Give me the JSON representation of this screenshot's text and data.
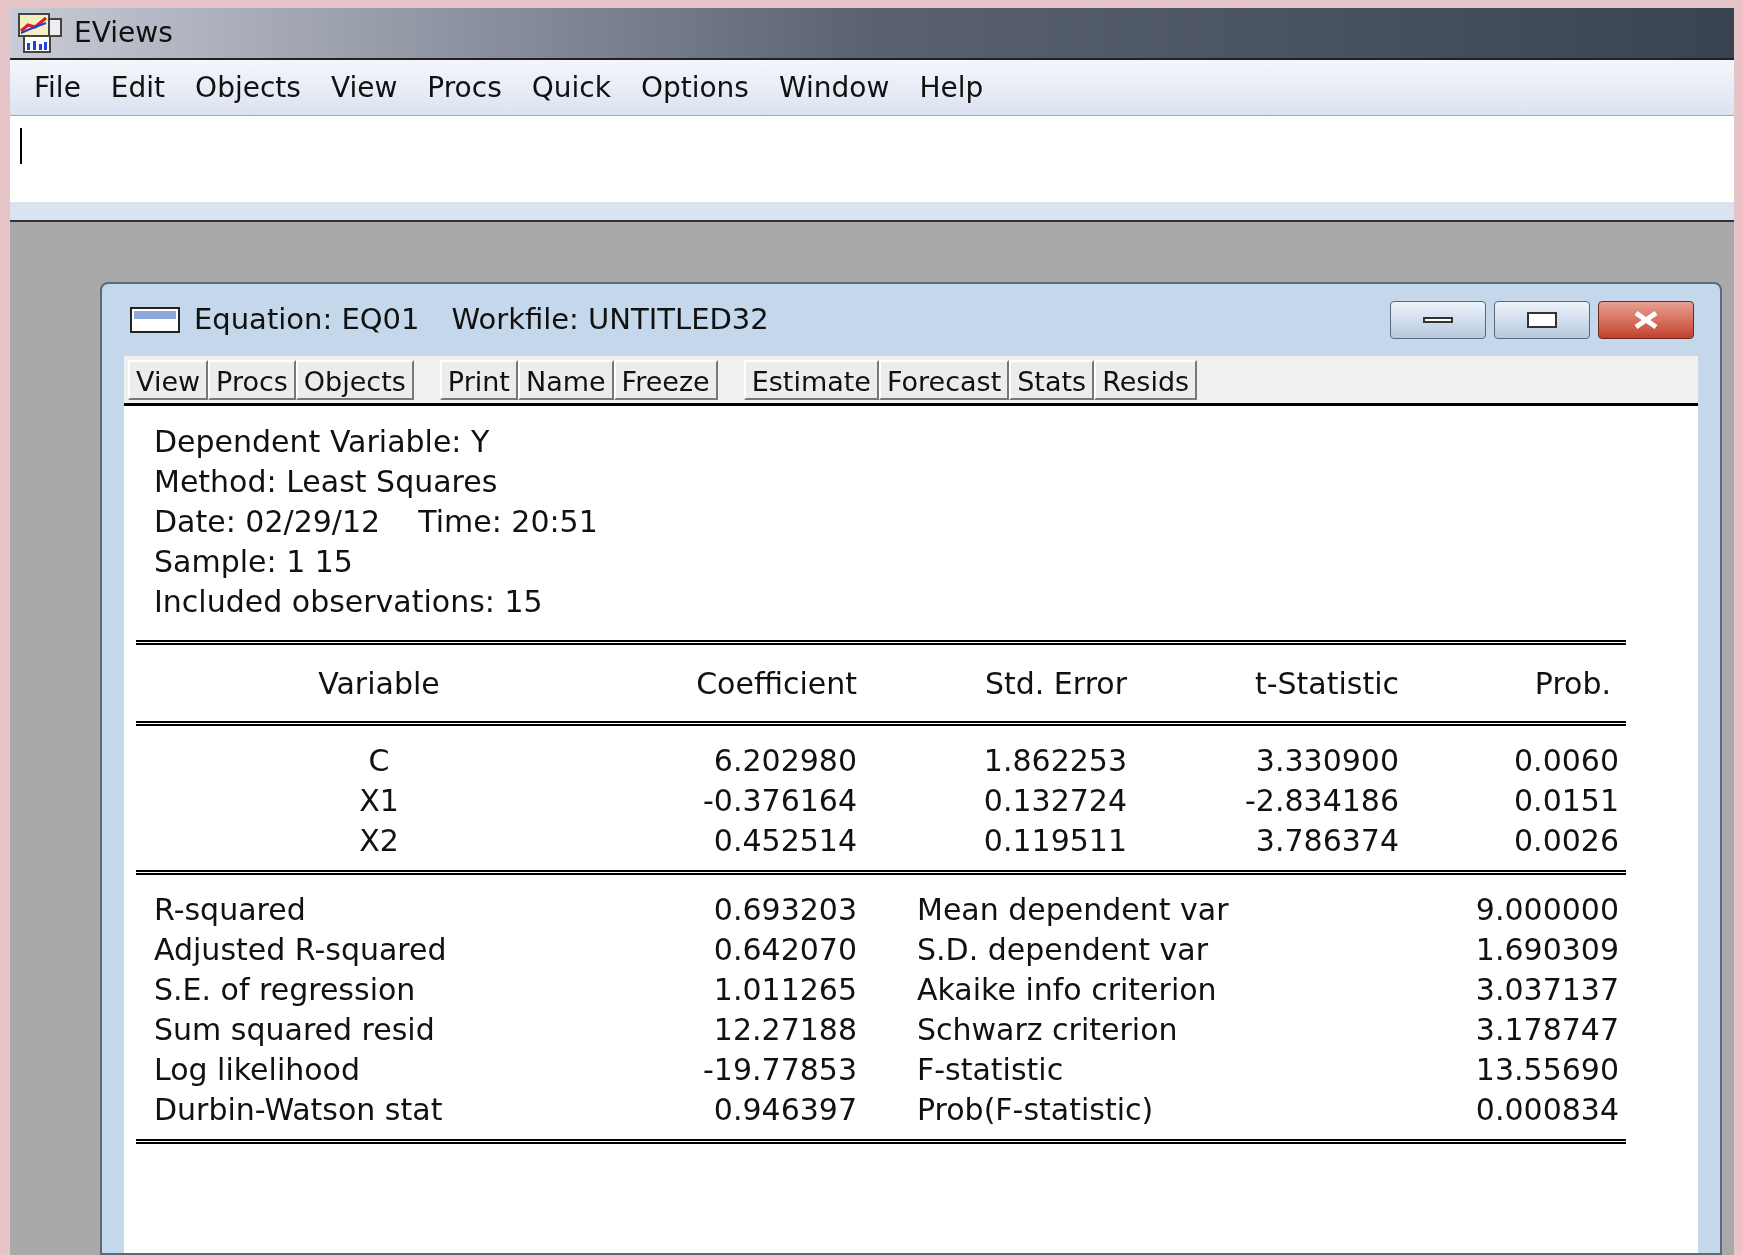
{
  "app": {
    "title": "EViews",
    "menu": [
      "File",
      "Edit",
      "Objects",
      "View",
      "Procs",
      "Quick",
      "Options",
      "Window",
      "Help"
    ]
  },
  "equation_window": {
    "title": "Equation: EQ01",
    "workfile": "Workfile: UNTITLED32",
    "toolbar_groups": [
      [
        "View",
        "Procs",
        "Objects"
      ],
      [
        "Print",
        "Name",
        "Freeze"
      ],
      [
        "Estimate",
        "Forecast",
        "Stats",
        "Resids"
      ]
    ],
    "header_lines": [
      "Dependent Variable: Y",
      "Method: Least Squares",
      "Date: 02/29/12    Time: 20:51",
      "Sample: 1 15",
      "Included observations: 15"
    ],
    "table": {
      "columns": [
        "Variable",
        "Coefficient",
        "Std. Error",
        "t-Statistic",
        "Prob."
      ],
      "rows": [
        [
          "C",
          "6.202980",
          "1.862253",
          "3.330900",
          "0.0060"
        ],
        [
          "X1",
          "-0.376164",
          "0.132724",
          "-2.834186",
          "0.0151"
        ],
        [
          "X2",
          "0.452514",
          "0.119511",
          "3.786374",
          "0.0026"
        ]
      ]
    },
    "statistics": [
      {
        "label": "R-squared",
        "value": "0.693203",
        "label2": "Mean dependent var",
        "value2": "9.000000"
      },
      {
        "label": "Adjusted R-squared",
        "value": "0.642070",
        "label2": "S.D. dependent var",
        "value2": "1.690309"
      },
      {
        "label": "S.E. of regression",
        "value": "1.011265",
        "label2": "Akaike info criterion",
        "value2": "3.037137"
      },
      {
        "label": "Sum squared resid",
        "value": "12.27188",
        "label2": "Schwarz criterion",
        "value2": "3.178747"
      },
      {
        "label": "Log likelihood",
        "value": "-19.77853",
        "label2": "F-statistic",
        "value2": "13.55690"
      },
      {
        "label": "Durbin-Watson stat",
        "value": "0.946397",
        "label2": "Prob(F-statistic)",
        "value2": "0.000834"
      }
    ]
  }
}
